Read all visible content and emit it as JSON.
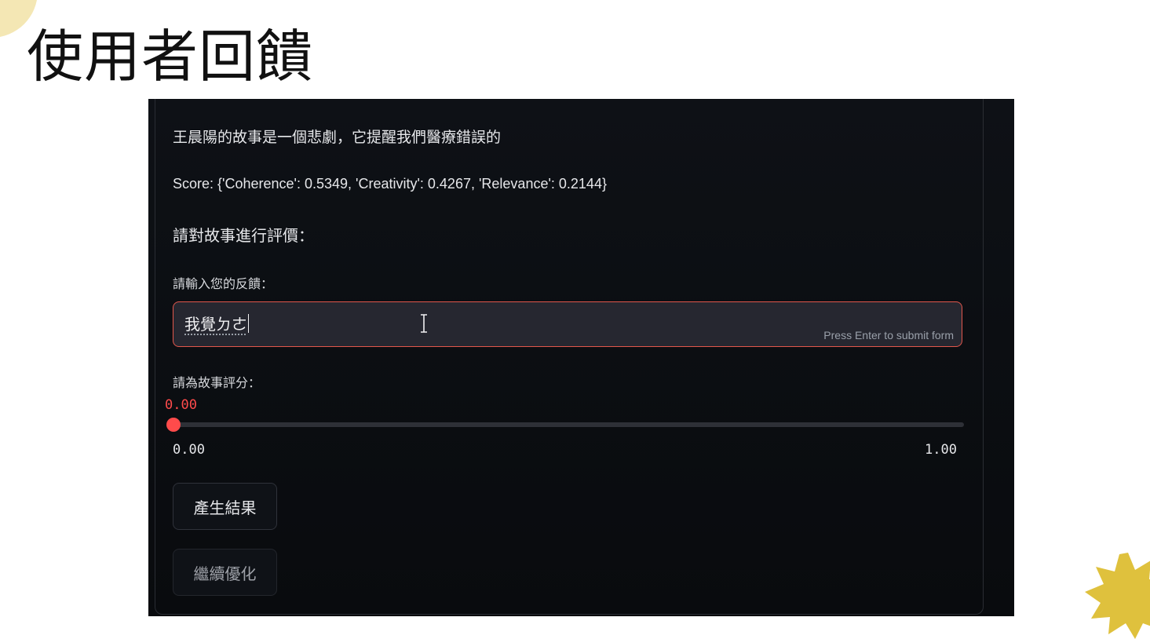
{
  "slide": {
    "title": "使用者回饋"
  },
  "app": {
    "story_text": "王晨陽的故事是一個悲劇，它提醒我們醫療錯誤的",
    "score_text": "Score: {'Coherence': 0.5349, 'Creativity': 0.4267, 'Relevance': 0.2144}",
    "evaluation_heading": "請對故事進行評價：",
    "feedback": {
      "label": "請輸入您的反饋：",
      "value": "我覺ㄉㄜ",
      "hint": "Press Enter to submit form"
    },
    "rating": {
      "label": "請為故事評分：",
      "current_value": "0.00",
      "min_label": "0.00",
      "max_label": "1.00",
      "fraction": 0
    },
    "buttons": {
      "generate_label": "產生結果",
      "optimize_label": "繼續優化"
    }
  },
  "colors": {
    "accent": "#ff4b4b",
    "input_border": "#e2574c",
    "app_background": "#0e1116",
    "decoration_yellow": "#dfc13d",
    "decoration_cream": "#f4e7b4"
  },
  "icons": {
    "text_cursor": "i-beam-cursor-icon"
  }
}
